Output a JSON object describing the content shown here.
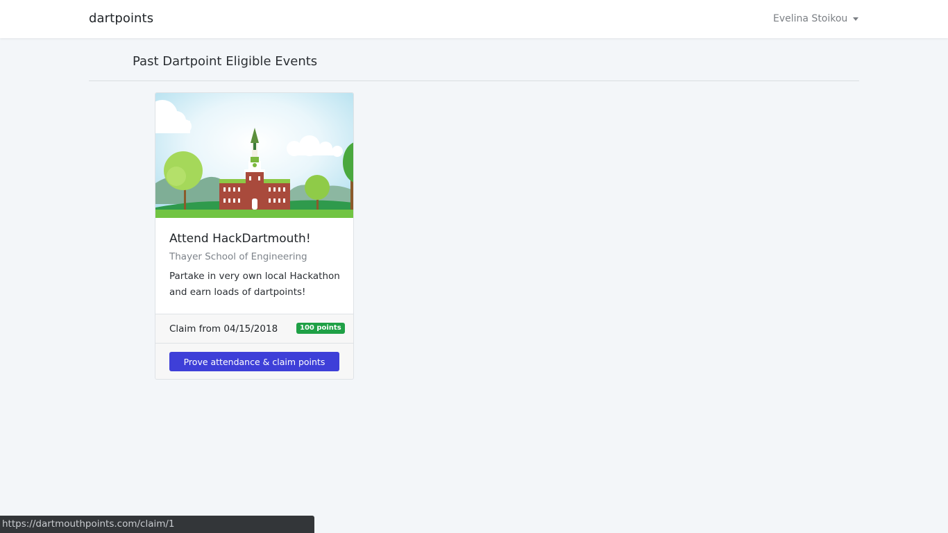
{
  "navbar": {
    "brand": "dartpoints",
    "user_name": "Evelina Stoikou"
  },
  "page": {
    "heading": "Past Dartpoint Eligible Events"
  },
  "events": [
    {
      "title": "Attend HackDartmouth!",
      "location": "Thayer School of Engineering",
      "description": "Partake in very own local Hackathon and earn loads of dartpoints!",
      "claim_from": "Claim from 04/15/2018",
      "points_badge": "100 points",
      "button_label": "Prove attendance & claim points"
    }
  ],
  "status_bar": {
    "url": "https://dartmouthpoints.com/claim/1"
  },
  "colors": {
    "primary_button": "#3e3fd8",
    "points_badge": "#1fa046",
    "page_background": "#f3f6f9"
  }
}
